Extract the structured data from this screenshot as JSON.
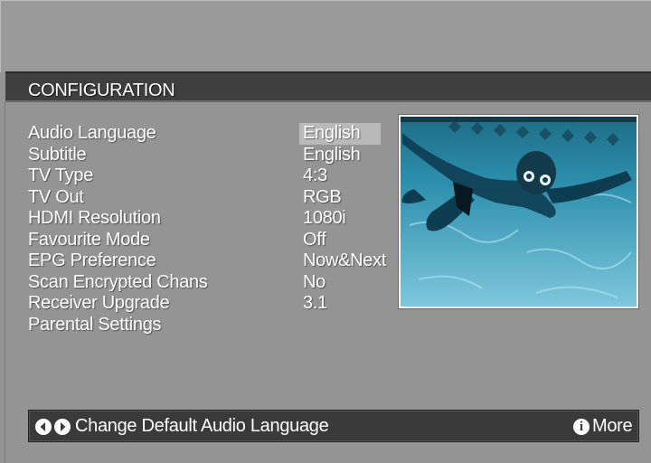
{
  "header": {
    "title": "CONFIGURATION"
  },
  "menu": {
    "items": [
      {
        "label": "Audio Language",
        "value": "English"
      },
      {
        "label": "Subtitle",
        "value": "English"
      },
      {
        "label": "TV Type",
        "value": "4:3"
      },
      {
        "label": "TV Out",
        "value": "RGB"
      },
      {
        "label": "HDMI Resolution",
        "value": "1080i"
      },
      {
        "label": "Favourite Mode",
        "value": "Off"
      },
      {
        "label": "EPG Preference",
        "value": "Now&Next"
      },
      {
        "label": "Scan Encrypted Chans",
        "value": "No"
      },
      {
        "label": "Receiver Upgrade",
        "value": "3.1"
      },
      {
        "label": "Parental Settings",
        "value": ""
      }
    ],
    "selected_index": 0
  },
  "footer": {
    "help_text": "Change Default Audio Language",
    "more_label": "More",
    "left_icon": "arrow-left-icon",
    "right_icon": "arrow-right-icon",
    "info_icon": "info-icon"
  },
  "colors": {
    "background": "#949494",
    "title_bar": "#3f3f3f",
    "selection": "#b9b9b9",
    "help_bar": "#3a3a3a"
  }
}
